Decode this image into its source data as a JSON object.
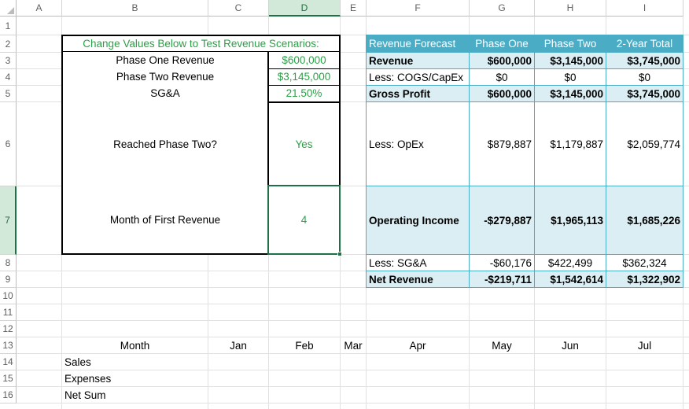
{
  "columns": [
    "A",
    "B",
    "C",
    "D",
    "E",
    "F",
    "G",
    "H",
    "I"
  ],
  "selected_column": "D",
  "rows": [
    "1",
    "2",
    "3",
    "4",
    "5",
    "6",
    "7",
    "8",
    "9",
    "10",
    "11",
    "12",
    "13",
    "14",
    "15",
    "16"
  ],
  "selected_row": "7",
  "inputs": {
    "header": "Change Values Below to Test Revenue Scenarios:",
    "phase_one_label": "Phase One Revenue",
    "phase_one_value": "$600,000",
    "phase_two_label": "Phase Two Revenue",
    "phase_two_value": "$3,145,000",
    "sga_label": "SG&A",
    "sga_value": "21.50%",
    "reached_label": "Reached Phase Two?",
    "reached_value": "Yes",
    "month_label": "Month of First Revenue",
    "month_value": "4"
  },
  "forecast": {
    "headers": [
      "Revenue Forecast",
      "Phase One",
      "Phase Two",
      "2-Year Total"
    ],
    "rows": [
      {
        "label": "Revenue",
        "values": [
          "$600,000",
          "$3,145,000",
          "$3,745,000"
        ]
      },
      {
        "label": "Less: COGS/CapEx",
        "values": [
          "$0",
          "$0",
          "$0"
        ]
      },
      {
        "label": "Gross Profit",
        "values": [
          "$600,000",
          "$3,145,000",
          "$3,745,000"
        ]
      },
      {
        "label": "Less: OpEx",
        "values": [
          "$879,887",
          "$1,179,887",
          "$2,059,774"
        ]
      },
      {
        "label": "Operating Income",
        "values": [
          "-$279,887",
          "$1,965,113",
          "$1,685,226"
        ]
      },
      {
        "label": "Less: SG&A",
        "values": [
          "-$60,176",
          "$422,499",
          "$362,324"
        ]
      },
      {
        "label": "Net Revenue",
        "values": [
          "-$219,711",
          "$1,542,614",
          "$1,322,902"
        ]
      }
    ]
  },
  "monthly": {
    "month_label": "Month",
    "months": [
      "Jan",
      "Feb",
      "Mar",
      "Apr",
      "May",
      "Jun",
      "Jul"
    ],
    "row_labels": [
      "Sales",
      "Expenses",
      "Net Sum"
    ]
  },
  "colors": {
    "accent_green": "#2aa146",
    "table_fill": "#daeef3",
    "table_border": "#4bacc6",
    "header_text": "#ffffff"
  }
}
